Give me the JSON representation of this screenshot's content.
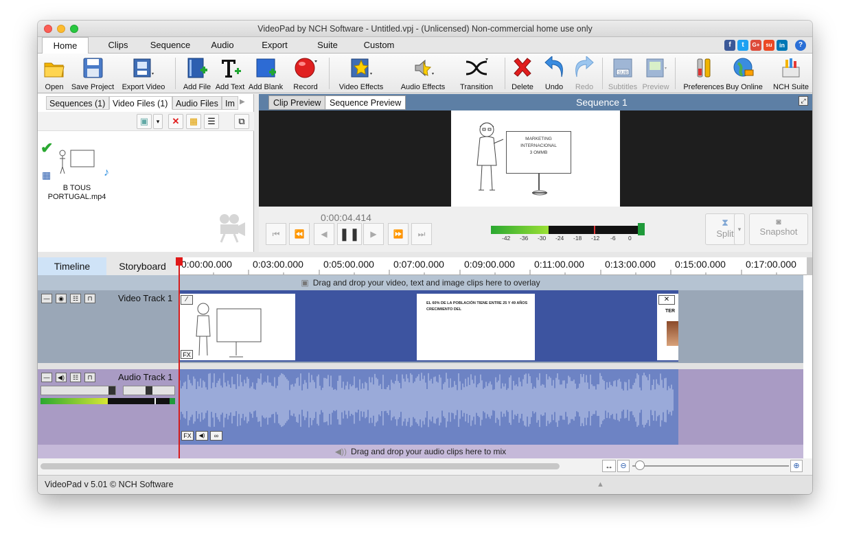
{
  "window": {
    "title": "VideoPad by NCH Software - Untitled.vpj - (Unlicensed) Non-commercial home use only"
  },
  "menu_tabs": [
    "Home",
    "Clips",
    "Sequence",
    "Audio",
    "Export",
    "Suite",
    "Custom"
  ],
  "toolbar": {
    "open": "Open",
    "save_project": "Save Project",
    "export_video": "Export Video",
    "add_file": "Add File",
    "add_text": "Add Text",
    "add_blank": "Add Blank",
    "record": "Record",
    "video_effects": "Video Effects",
    "audio_effects": "Audio Effects",
    "transition": "Transition",
    "delete": "Delete",
    "undo": "Undo",
    "redo": "Redo",
    "subtitles": "Subtitles",
    "preview": "Preview",
    "preferences": "Preferences",
    "buy_online": "Buy Online",
    "nch_suite": "NCH Suite"
  },
  "social": {
    "facebook": "f",
    "twitter": "t",
    "googleplus": "G+",
    "stumble": "su",
    "linkedin": "in",
    "help": "?"
  },
  "bin": {
    "tabs": [
      "Sequences (1)",
      "Video Files (1)",
      "Audio Files",
      "Im"
    ],
    "file_name": "B TOUS PORTUGAL.mp4"
  },
  "preview": {
    "clip_tab": "Clip Preview",
    "sequence_tab": "Sequence Preview",
    "sequence_title": "Sequence 1",
    "board_text": "MARKETING INTERNACIONAL\n3 OMMB",
    "timecode": "0:00:04.414",
    "meter_labels": [
      "-42",
      "-36",
      "-30",
      "-24",
      "-18",
      "-12",
      "-6",
      "0"
    ],
    "split": "Split",
    "snapshot": "Snapshot"
  },
  "timeline": {
    "tab_timeline": "Timeline",
    "tab_storyboard": "Storyboard",
    "ruler": [
      "0:00:00.000",
      "0:03:00.000",
      "0:05:00.000",
      "0:07:00.000",
      "0:09:00.000",
      "0:11:00.000",
      "0:13:00.000",
      "0:15:00.000",
      "0:17:00.000"
    ],
    "overlay_hint": "Drag and drop your video, text and image clips here to overlay",
    "video_track": "Video Track 1",
    "audio_track": "Audio Track 1",
    "clip2_line1": "EL 60% DE LA POBLACIÓN TIENE ENTRE 25 Y 49 AÑOS",
    "clip2_line2": "CRECIMIENTO DEL",
    "clip3_text": "TER",
    "fx": "FX",
    "mix_hint": "Drag and drop your audio clips here to mix"
  },
  "status": "VideoPad v 5.01 © NCH Software",
  "colors": {
    "accent_blue": "#5d7fa5",
    "video_track": "#3d54a0",
    "audio_track": "#6d83c4",
    "playhead": "#d51b1b"
  }
}
